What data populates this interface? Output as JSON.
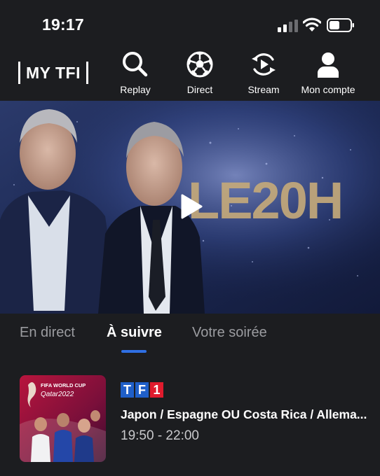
{
  "status_bar": {
    "time": "19:17"
  },
  "header": {
    "logo_text": "MY TFI",
    "nav": [
      {
        "label": "Replay",
        "icon": "search-icon"
      },
      {
        "label": "Direct",
        "icon": "soccer-ball-icon"
      },
      {
        "label": "Stream",
        "icon": "stream-icon"
      },
      {
        "label": "Mon compte",
        "icon": "user-icon"
      }
    ]
  },
  "hero": {
    "show_logo_text": "LE20H",
    "play_icon": "play-icon"
  },
  "tabs": [
    {
      "label": "En direct",
      "active": false
    },
    {
      "label": "À suivre",
      "active": true
    },
    {
      "label": "Votre soirée",
      "active": false
    }
  ],
  "program": {
    "channel": "TF1",
    "title": "Japon / Espagne OU Costa Rica / Allema...",
    "time": "19:50 - 22:00",
    "thumb_text": {
      "line1": "FIFA WORLD CUP",
      "line2": "Qatar2022"
    }
  },
  "colors": {
    "background": "#1c1d20",
    "accent": "#2f6fe4",
    "tf1_blue": "#1f5fc8",
    "tf1_red": "#e01b2d"
  }
}
